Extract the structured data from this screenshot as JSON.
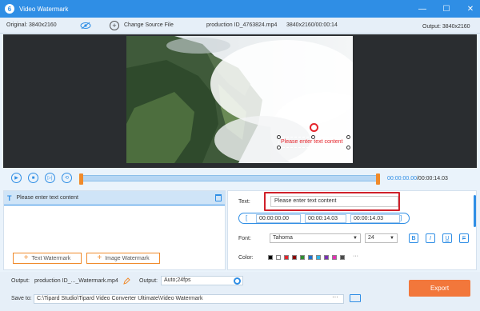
{
  "window": {
    "title": "Video Watermark",
    "logo_icon": "app-logo-icon"
  },
  "infobar": {
    "original_label": "Original: 3840x2160",
    "change_source": "Change Source File",
    "file_name": "production ID_4763824.mp4",
    "file_info": "3840x2160/00:00:14",
    "output_label": "Output: 3840x2160"
  },
  "preview": {
    "watermark_text": "Please enter text content"
  },
  "timeline": {
    "current_time": "00:00:00.00",
    "total_time": "/00:00:14.03"
  },
  "watermarks": {
    "item_label": "Please enter text content",
    "add_text": "Text Watermark",
    "add_image": "Image Watermark"
  },
  "editor": {
    "text_label": "Text:",
    "text_value": "Please enter text content",
    "start_time": "00:00:00.00",
    "end_time": "00:00:14.03",
    "duration": "00:00:14.03",
    "font_label": "Font:",
    "font_name": "Tahoma",
    "font_size": "24",
    "bold": "B",
    "italic": "I",
    "underline": "U",
    "strike": "F",
    "color_label": "Color:",
    "swatches": [
      "#000000",
      "#ffffff",
      "#e5242b",
      "#8b0000",
      "#2f8e2f",
      "#1e6fd0",
      "#2fb4e5",
      "#7b2fb5",
      "#e52fb4",
      "#4a4a4a"
    ],
    "more_colors": "···"
  },
  "footer": {
    "output_label": "Output:",
    "output_file": "production ID_..._Watermark.mp4",
    "output_label2": "Output:",
    "output_format": "Auto;24fps",
    "save_label": "Save to:",
    "save_path": "C:\\Tipard Studio\\Tipard Video Converter Ultimate\\Video Watermark",
    "dots": "···",
    "export": "Export"
  }
}
